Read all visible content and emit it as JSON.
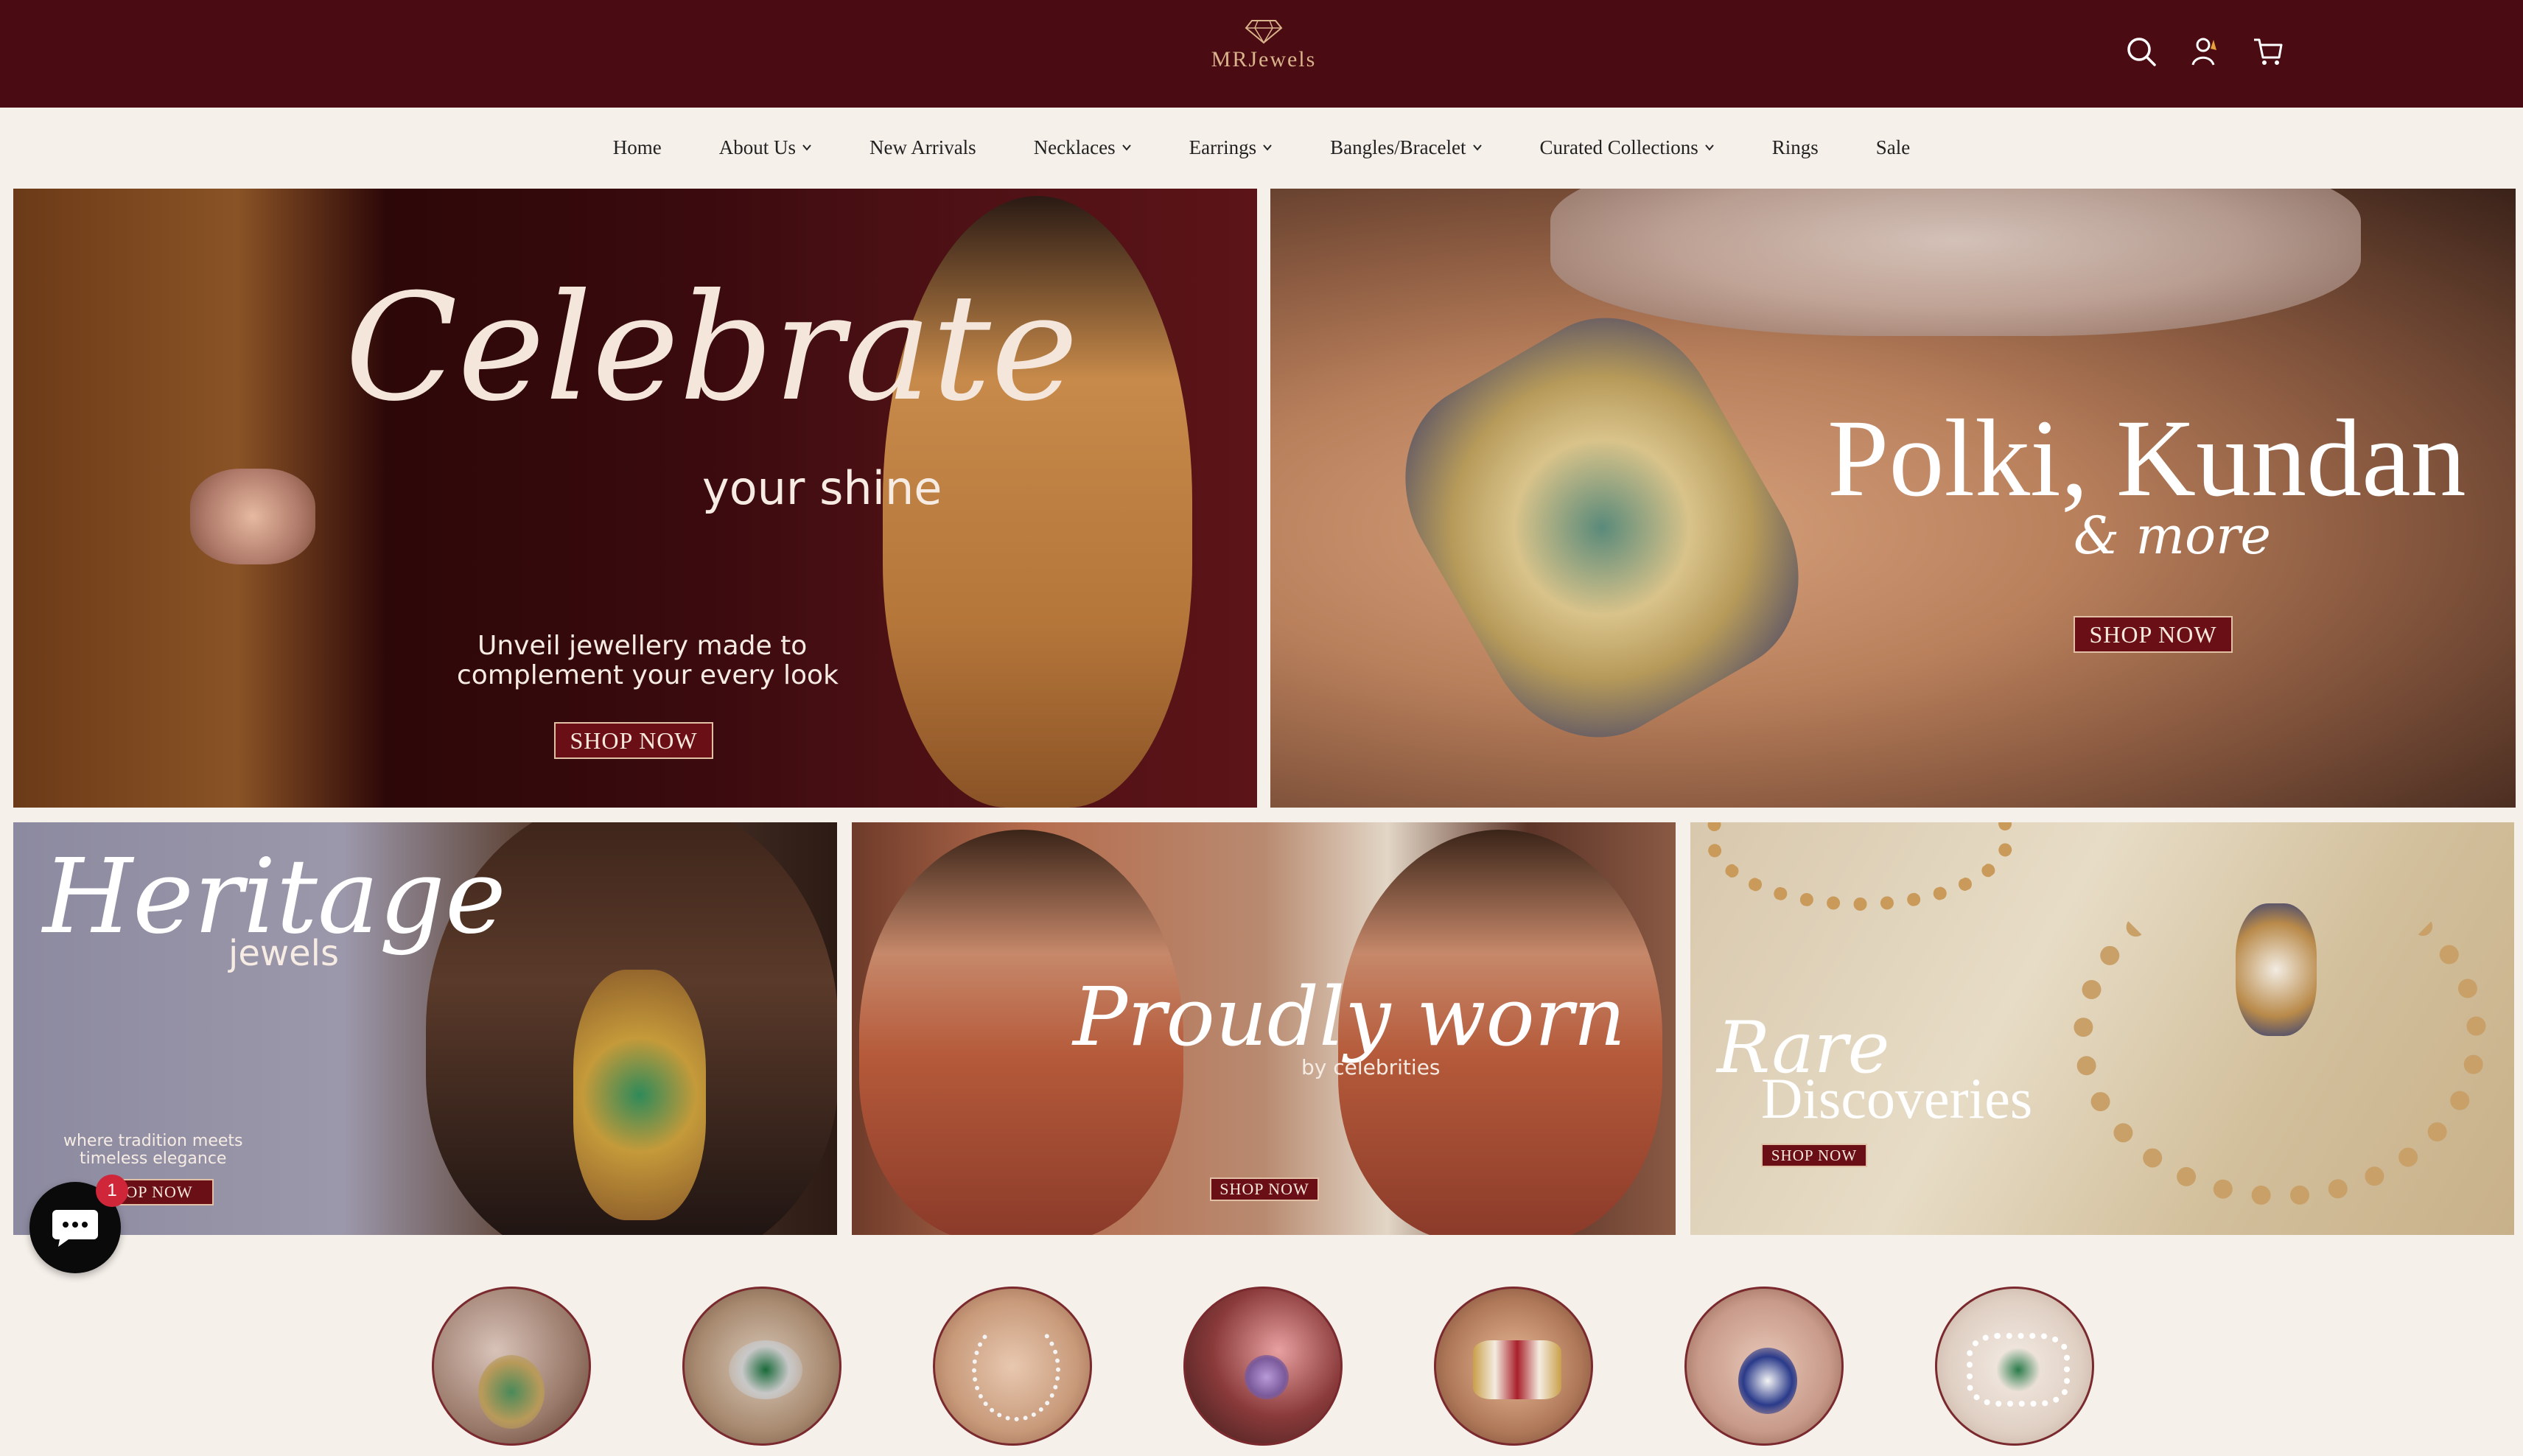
{
  "header": {
    "logo_text": "MRJewels",
    "icons": [
      "search-icon",
      "account-icon",
      "cart-icon"
    ],
    "bg_color": "#4a0c12",
    "accent_color": "#d9b38c"
  },
  "nav": {
    "items": [
      {
        "label": "Home"
      },
      {
        "label": "About Us"
      },
      {
        "label": "New Arrivals"
      },
      {
        "label": "Necklaces"
      },
      {
        "label": "Earrings"
      },
      {
        "label": "Bangles/Bracelet"
      },
      {
        "label": "Curated Collections"
      },
      {
        "label": "Rings"
      },
      {
        "label": "Sale"
      }
    ]
  },
  "banners": {
    "celebrate": {
      "title": "Celebrate",
      "subtitle": "your shine",
      "tagline_1": "Unveil jewellery made to",
      "tagline_2": "complement your every look",
      "button": "SHOP NOW"
    },
    "polki": {
      "title": "Polki, Kundan",
      "subtitle": "& more",
      "button": "SHOP NOW"
    },
    "heritage": {
      "title": "Heritage",
      "subtitle": "jewels",
      "tagline_1": "where tradition meets",
      "tagline_2": "timeless elegance",
      "button": "OP NOW"
    },
    "proudly": {
      "title": "Proudly worn",
      "subtitle": "by celebrities",
      "button": "SHOP NOW"
    },
    "rare": {
      "title": "Rare",
      "subtitle": "Discoveries",
      "button": "SHOP NOW"
    }
  },
  "categories": [
    "necklace-set",
    "rings-pair",
    "diamond-necklace",
    "cocktail-ring",
    "kundan-bangle",
    "pendant",
    "choker"
  ],
  "chat": {
    "badge_count": "1"
  }
}
